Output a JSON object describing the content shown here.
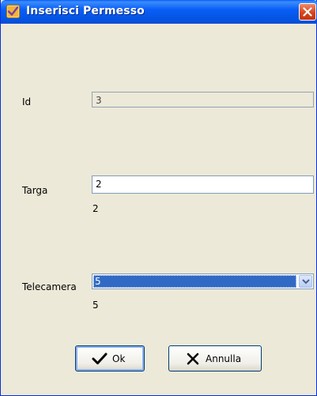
{
  "window": {
    "title": "Inserisci Permesso"
  },
  "form": {
    "id": {
      "label": "Id",
      "value": "3"
    },
    "targa": {
      "label": "Targa",
      "value": "2",
      "echo": "2"
    },
    "telecamera": {
      "label": "Telecamera",
      "selected": "5",
      "echo": "5"
    }
  },
  "buttons": {
    "ok": "Ok",
    "annulla": "Annulla"
  },
  "icons": {
    "app": "shield-check-icon",
    "close": "close-icon",
    "dropdown": "chevron-down-icon",
    "ok": "checkmark-icon",
    "cancel": "x-icon"
  },
  "colors": {
    "titlebar": "#0a5ef6",
    "window_bg": "#ece9d8",
    "selection": "#316ac5",
    "close_button": "#d9441f"
  }
}
